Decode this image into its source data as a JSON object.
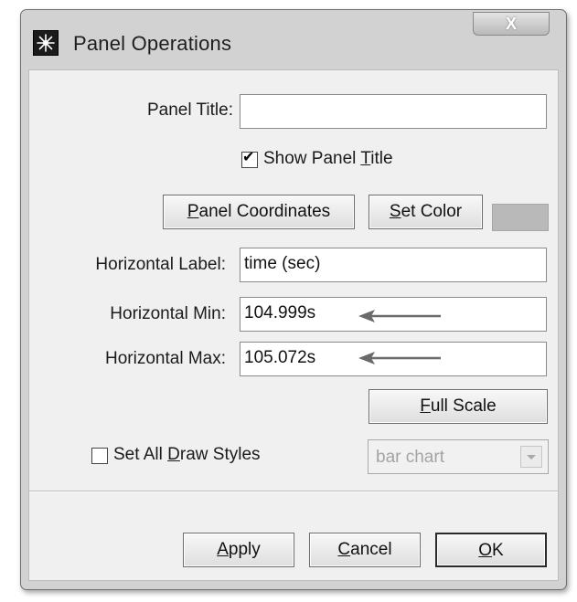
{
  "window": {
    "title": "Panel Operations",
    "close_glyph": "X",
    "icon": "panel-app-icon"
  },
  "form": {
    "panel_title_label": "Panel Title:",
    "panel_title_value": "",
    "show_panel_title": {
      "label_pre": "Show Panel ",
      "label_key": "T",
      "label_post": "itle",
      "checked": true
    },
    "panel_coordinates_button": {
      "key": "P",
      "rest": "anel Coordinates"
    },
    "set_color_button": {
      "key": "S",
      "rest": "et Color"
    },
    "color_swatch": "#b9b9b9",
    "horizontal_label_label": "Horizontal Label:",
    "horizontal_label_value": "time (sec)",
    "horizontal_min_label": "Horizontal Min:",
    "horizontal_min_value": "104.999s",
    "horizontal_max_label": "Horizontal Max:",
    "horizontal_max_value": "105.072s",
    "full_scale_button": {
      "key": "F",
      "rest": "ull Scale"
    },
    "set_all_draw_styles": {
      "label_pre": "Set All ",
      "label_key": "D",
      "label_post": "raw Styles",
      "checked": false
    },
    "draw_style_select": {
      "selected": "bar chart",
      "enabled": false
    }
  },
  "footer": {
    "apply_button": {
      "key": "A",
      "rest": "pply"
    },
    "cancel_button": {
      "key": "C",
      "rest": "ancel"
    },
    "ok_button": {
      "key": "O",
      "rest": "K"
    }
  },
  "annotations": {
    "arrow_color": "#6a6a6a"
  }
}
